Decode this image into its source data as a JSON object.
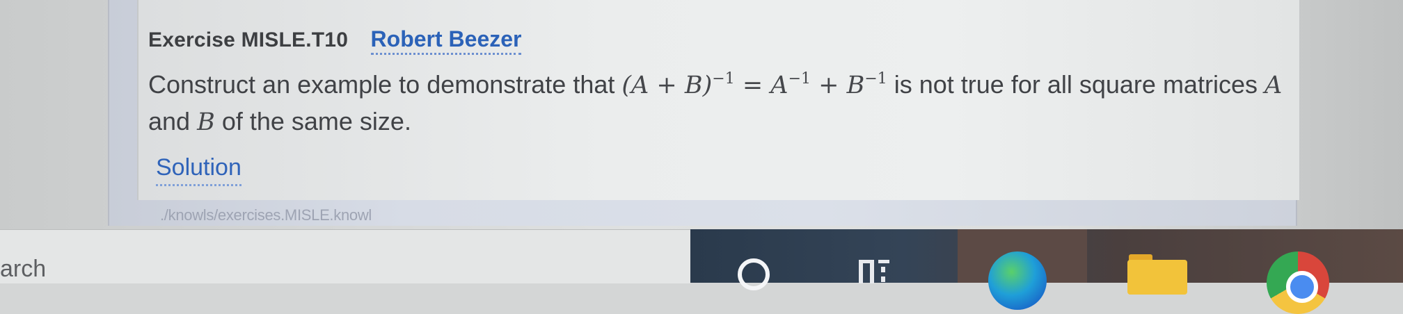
{
  "exercise": {
    "label": "Exercise MISLE.T10",
    "author": "Robert Beezer",
    "statement": {
      "part1": "Construct an example to demonstrate that ",
      "math1": "(A + B)",
      "exp1": "−1",
      "math2": " = A",
      "exp2": "−1",
      "math3": " + B",
      "exp3": "−1",
      "part2": " is not true for all square matrices ",
      "varA": "A",
      "part3": " and ",
      "varB": "B",
      "part4": " of the same size."
    },
    "solution_label": "Solution",
    "source_path": "./knowls/exercises.MISLE.knowl"
  },
  "taskbar": {
    "search_text": "arch",
    "icons": [
      "cortana-icon",
      "task-view-icon",
      "edge-icon",
      "file-explorer-icon",
      "chrome-icon"
    ]
  }
}
